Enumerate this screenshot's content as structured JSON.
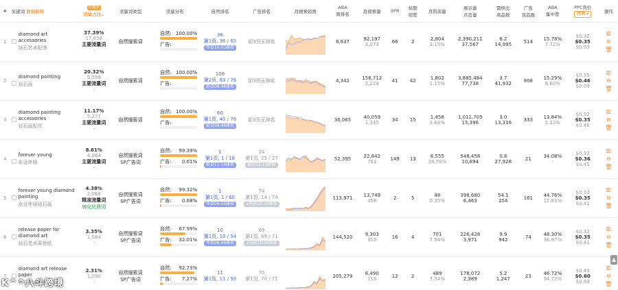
{
  "headers": {
    "idx": "#",
    "keyword": "关键词",
    "keyword_badge": "数据解释",
    "traffic_badge": "月增长",
    "traffic": "流量占比",
    "type": "流量词类型",
    "dist": "流量分布",
    "natural_rank": "自然排名",
    "ad_rank": "广告排名",
    "trend": "月搜索趋势",
    "aba_rank": "ABA\n周排名",
    "monthly_search": "月搜索量",
    "spr": "SPR",
    "title_density": "标题\n密度",
    "monthly_purchase": "月购买量",
    "impressions_clicks": "展示量\n点击量",
    "demand_ratio": "需供比\n商品数",
    "ad_products": "广告\n竞品数",
    "aba_concentration": "ABA\n集中度",
    "ppc": "PPC竞价",
    "ppc_btn": "精确 ▾",
    "ops": "操作"
  },
  "dist_labels": {
    "natural": "自然:",
    "ad": "广告:"
  },
  "rows": [
    {
      "idx": "1",
      "en": "diamond art accessories",
      "cn": "钻石艺术配饰",
      "share": "37.39%",
      "share_sub": "17,658",
      "flow_label": "主要流量词",
      "flow_sub": "-",
      "type": "自然搜索词",
      "nat_pct": "100.00%",
      "nat_fill": 1.0,
      "ad_pct": "",
      "ad_fill": 0,
      "nat_rank": "36",
      "nat_rank_page": "第1页, 36 / 65",
      "nat_rank_pill": "今日10:03排名",
      "ad_rank": "",
      "ad_rank_page": "前3页无排名",
      "ad_rank_pill": "",
      "trend": [
        0.55,
        0.5,
        0.75,
        0.6,
        0.62,
        0.65,
        0.6,
        0.58,
        0.62,
        0.6,
        0.63,
        0.62,
        0.7,
        0.72,
        0.74
      ],
      "trend2": [
        0.2,
        0.45,
        0.4,
        0.42,
        0.5,
        0.48,
        0.55,
        0.6,
        0.62,
        0.58,
        0.66,
        0.62,
        0.7,
        0.68,
        0.72
      ],
      "aba": "8,637",
      "search": "92,197",
      "search_sub": "3,073",
      "spr": "66",
      "density": "2",
      "purchase": "2,904",
      "purchase_sub": "3.15%",
      "impr": "2,390,211",
      "clicks": "37,567",
      "ratio": "6.2",
      "products": "14,995",
      "ad_products": "514",
      "conc": "15.78%",
      "conc_sub": "7.72%",
      "ppc_top": "$0.32",
      "ppc": "$0.35",
      "ppc_bot": "$0.93"
    },
    {
      "idx": "2",
      "en": "diamond painting",
      "cn": "钻石画",
      "share": "20.32%",
      "share_sub": "9,598",
      "flow_label": "主要流量词",
      "flow_sub": "-",
      "type": "自然搜索词",
      "nat_pct": "100.00%",
      "nat_fill": 1.0,
      "ad_pct": "",
      "ad_fill": 0,
      "nat_rank": "106",
      "nat_rank_page": "第2页, 63 / 76",
      "nat_rank_pill": "前日08:48排名",
      "ad_rank": "",
      "ad_rank_page": "前3页无排名",
      "ad_rank_pill": "",
      "trend": [
        0.6,
        0.55,
        0.62,
        0.58,
        0.5,
        0.52,
        0.48,
        0.55,
        0.5,
        0.45,
        0.5,
        0.48,
        0.4,
        0.35,
        0.3
      ],
      "trend2": [
        0.5,
        0.48,
        0.55,
        0.52,
        0.45,
        0.5,
        0.42,
        0.48,
        0.44,
        0.4,
        0.45,
        0.42,
        0.35,
        0.3,
        0.25
      ],
      "aba": "4,342",
      "search": "156,712",
      "search_sub": "5,224",
      "spr": "41",
      "density": "42",
      "purchase": "1,802",
      "purchase_sub": "1.15%",
      "impr": "3,885,484",
      "clicks": "77,738",
      "ratio": "3.7",
      "products": "41,932",
      "ad_products": "908",
      "conc": "15.29%",
      "conc_sub": "6.60%",
      "ppc_top": "$0.35",
      "ppc": "$0.46",
      "ppc_bot": "$0.09"
    },
    {
      "idx": "3",
      "en": "diamond painting accessories",
      "cn": "钻石画配件",
      "share": "11.17%",
      "share_sub": "5,277",
      "flow_label": "主要流量词",
      "flow_sub": "-",
      "type": "自然搜索词",
      "nat_pct": "100.00%",
      "nat_fill": 1.0,
      "ad_pct": "",
      "ad_fill": 0,
      "nat_rank": "60",
      "nat_rank_page": "第1页, 40 / 76",
      "nat_rank_pill": "前日08:48排名",
      "ad_rank": "",
      "ad_rank_page": "前3页无排名",
      "ad_rank_pill": "",
      "trend": [
        0.65,
        0.62,
        0.6,
        0.55,
        0.58,
        0.5,
        0.52,
        0.48,
        0.45,
        0.5,
        0.4,
        0.42,
        0.35,
        0.3,
        0.28
      ],
      "trend2": [
        0.7,
        0.68,
        0.65,
        0.62,
        0.6,
        0.58,
        0.55,
        0.5,
        0.5,
        0.48,
        0.45,
        0.42,
        0.38,
        0.32,
        0.3
      ],
      "aba": "36,065",
      "search": "40,059",
      "search_sub": "1,335",
      "spr": "34",
      "density": "15",
      "purchase": "1,458",
      "purchase_sub": "3.64%",
      "impr": "1,011,705",
      "clicks": "15,396",
      "ratio": "3.0",
      "products": "13,316",
      "ad_products": "333",
      "conc": "13.84%",
      "conc_sub": "5.22%",
      "ppc_top": "$0.32",
      "ppc": "$0.35",
      "ppc_bot": "$0.46"
    },
    {
      "idx": "4",
      "en": "forever young",
      "cn": "永远年轻",
      "share": "8.61%",
      "share_sub": "4,064",
      "flow_label": "主要流量词",
      "flow_sub": "-",
      "type": "自然搜索词",
      "type2": "SP广告词",
      "nat_pct": "99.39%",
      "nat_fill": 0.99,
      "ad_pct": "0.61%",
      "ad_fill": 0.04,
      "nat_rank": "1",
      "nat_rank_page": "第1页, 1 / 16",
      "nat_rank_pill": "前日11:14排名",
      "ad_rank": "24",
      "ad_rank_page": "第1页, 25 / 27",
      "ad_rank_pill": "前日11:13排名",
      "trend": [
        0.4,
        0.5,
        0.45,
        0.6,
        0.55,
        0.5,
        0.58,
        0.62,
        0.5,
        0.4,
        0.45,
        0.55,
        0.5,
        0.45,
        0.5
      ],
      "trend2": [
        0.45,
        0.55,
        0.5,
        0.58,
        0.52,
        0.48,
        0.6,
        0.55,
        0.45,
        0.38,
        0.42,
        0.5,
        0.48,
        0.42,
        0.48
      ],
      "aba": "52,395",
      "search": "22,842",
      "search_sub": "761",
      "spr": "149",
      "density": "13",
      "purchase": "6,555",
      "purchase_sub": "28.70%",
      "impr": "548,458",
      "clicks": "10,894",
      "ratio": "0.8",
      "products": "27,928",
      "ad_products": "21",
      "conc": "34.08%",
      "conc_sub": "-",
      "ppc_top": "$0.32",
      "ppc": "$0.36",
      "ppc_bot": "$0.45"
    },
    {
      "idx": "5",
      "en": "forever young diamond painting",
      "cn": "永远年轻钻石画",
      "share": "4.38%",
      "share_sub": "2,069",
      "flow_label": "精准流量词",
      "flow_sub": "转化优质词",
      "type": "自然搜索词",
      "type2": "SP广告词",
      "nat_pct": "99.32%",
      "nat_fill": 0.99,
      "ad_pct": "0.68%",
      "ad_fill": 0.04,
      "nat_rank": "1",
      "nat_rank_page": "第1页, 1 / 60",
      "nat_rank_pill": "今日09:56排名",
      "ad_rank": "74",
      "ad_rank_page": "第1页, 14 / 74",
      "ad_rank_pill": "2天前15:34排名",
      "trend": [
        0.1,
        0.08,
        0.1,
        0.12,
        0.1,
        0.12,
        0.1,
        0.15,
        0.12,
        0.2,
        0.35,
        0.5,
        0.7,
        0.85,
        0.95
      ],
      "trend2": [
        0.05,
        0.05,
        0.08,
        0.08,
        0.1,
        0.1,
        0.1,
        0.12,
        0.1,
        0.15,
        0.3,
        0.45,
        0.6,
        0.8,
        0.9
      ],
      "aba": "113,971",
      "search": "13,749",
      "search_sub": "458",
      "spr": "2",
      "density": "5",
      "purchase": "48",
      "purchase_sub": "0.35%",
      "impr": "398,680",
      "clicks": "6,463",
      "ratio": "54.1",
      "products": "254",
      "ad_products": "161",
      "conc": "44.76%",
      "conc_sub": "17.81%",
      "ppc_top": "$0.32",
      "ppc": "$0.35",
      "ppc_bot": "$0.41"
    },
    {
      "idx": "6",
      "en": "release paper for diamond art",
      "cn": "钻石艺术离型纸",
      "share": "3.35%",
      "share_sub": "1,584",
      "flow_label": "",
      "flow_sub": "-",
      "type": "自然搜索词",
      "type2": "SP广告词",
      "nat_pct": "67.99%",
      "nat_fill": 0.68,
      "ad_pct": "32.01%",
      "ad_fill": 0.32,
      "nat_rank": "10",
      "nat_rank_page": "第1页, 10 / 54",
      "nat_rank_pill": "今日08:46排名",
      "ad_rank": "69",
      "ad_rank_page": "第1页, 69 / 71",
      "ad_rank_pill": "2天前15:34排名",
      "trend": [
        0.05,
        0.05,
        0.05,
        0.06,
        0.05,
        0.06,
        0.06,
        0.07,
        0.08,
        0.1,
        0.15,
        0.25,
        0.2,
        0.5,
        0.35
      ],
      "trend2": [
        0.05,
        0.05,
        0.05,
        0.05,
        0.05,
        0.05,
        0.06,
        0.06,
        0.07,
        0.08,
        0.12,
        0.2,
        0.18,
        0.4,
        0.3
      ],
      "aba": "144,520",
      "search": "9,303",
      "search_sub": "310",
      "spr": "16",
      "density": "4",
      "purchase": "701",
      "purchase_sub": "7.54%",
      "impr": "226,428",
      "clicks": "3,971",
      "ratio": "9.9",
      "products": "942",
      "ad_products": "74",
      "conc": "48.30%",
      "conc_sub": "36.97%",
      "ppc_top": "$0.32",
      "ppc": "$0.35",
      "ppc_bot": "$0.41"
    },
    {
      "idx": "7",
      "en": "diamond art release paper",
      "cn": "钻石艺术离型纸",
      "share": "2.31%",
      "share_sub": "1,090",
      "flow_label": "",
      "flow_sub": "-",
      "type": "自然搜索词",
      "type2": "SP广告词",
      "nat_pct": "92.73%",
      "nat_fill": 0.93,
      "ad_pct": "7.27%",
      "ad_fill": 0.07,
      "nat_rank": "11",
      "nat_rank_page": "第1页, 11 / 50",
      "nat_rank_pill": "",
      "ad_rank": "70",
      "ad_rank_page": "第1页, 70 / 71",
      "ad_rank_pill": "",
      "trend": [
        0.05,
        0.05,
        0.06,
        0.05,
        0.06,
        0.07,
        0.06,
        0.08,
        0.1,
        0.15,
        0.3,
        0.25,
        0.5,
        0.35,
        0.4
      ],
      "trend2": [
        0.05,
        0.05,
        0.05,
        0.05,
        0.05,
        0.06,
        0.06,
        0.07,
        0.08,
        0.12,
        0.25,
        0.2,
        0.42,
        0.3,
        0.35
      ],
      "aba": "205,279",
      "search": "6,490",
      "search_sub": "216",
      "spr": "12",
      "density": "2",
      "purchase": "489",
      "purchase_sub": "7.54%",
      "impr": "178,072",
      "clicks": "2,989",
      "ratio": "5.2",
      "products": "1,247",
      "ad_products": "23",
      "conc": "46.72%",
      "conc_sub": "34.72%",
      "ppc_top": "$0.45",
      "ppc": "$0.60",
      "ppc_bot": "$0.93"
    }
  ],
  "watermark": "K^^八斗跨境",
  "colors": {
    "accent": "#ff7a00",
    "pill": "#8da2f0",
    "bar": "#fbb03b",
    "trend_fill": "#fbd7b3",
    "trend_line2": "#9aa8f0"
  }
}
